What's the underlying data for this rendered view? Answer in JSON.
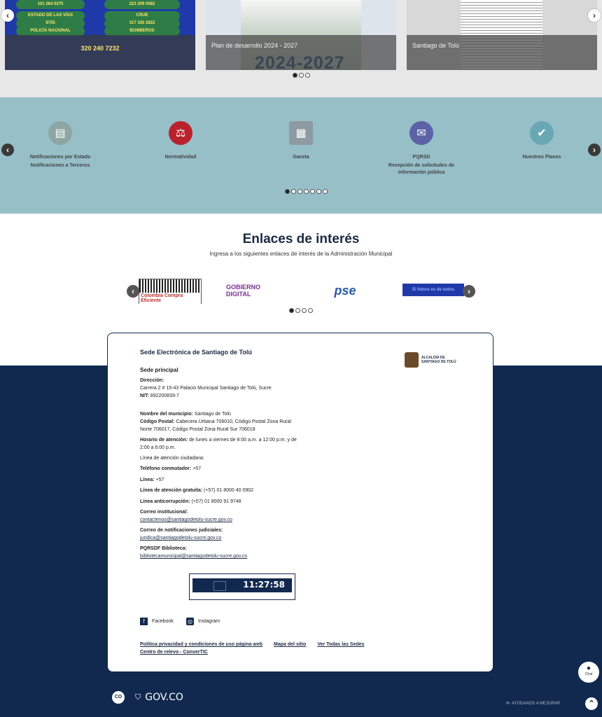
{
  "top_carousel": {
    "slides": [
      {
        "caption": "",
        "pills": [
          "101 284 0275",
          "223 209 0582",
          "ESTADO DE LAS VÍAS",
          "CRUE",
          "8755",
          "317 330 2822",
          "POLICÍA NACIONAL",
          "BOMBEROS",
          "320 240 7232"
        ]
      },
      {
        "caption": "Plan de desarrollo 2024 - 2027",
        "big_text": "2024-2027"
      },
      {
        "caption": "Santiago de Tolú"
      }
    ],
    "prev_icon": "chevron-left-icon",
    "next_icon": "chevron-right-icon",
    "dots_total": 3,
    "dots_active": 0
  },
  "services": {
    "items": [
      {
        "icon": "document-icon",
        "color": "#8da6a3",
        "label": "Notificaciones por Estado",
        "label2": "Notificaciones a Terceros"
      },
      {
        "icon": "law-book-icon",
        "color": "#b9222d",
        "label": "Normatividad",
        "label2": ""
      },
      {
        "icon": "newspaper-icon",
        "color": "#8e9aa2",
        "label": "Gaceta",
        "label2": ""
      },
      {
        "icon": "chat-bubble-icon",
        "color": "#5b62a6",
        "label": "PQRSD",
        "label2": "Recepción de solicitudes de información pública"
      },
      {
        "icon": "target-check-icon",
        "color": "#6aa7b4",
        "label": "Nuestros Planes",
        "label2": ""
      }
    ],
    "dots_total": 7,
    "dots_active": 0
  },
  "links": {
    "title": "Enlaces de interés",
    "subtitle": "Ingresa a los siguientes enlaces de interés de la Administración Municipal",
    "logos": [
      {
        "name": "Colombia Compra Eficiente",
        "color": "#b8332a"
      },
      {
        "name": "GOBIERNO DIGITAL",
        "color": "#7a2f8f"
      },
      {
        "name": "pse",
        "color": "#2b5aa8"
      },
      {
        "name": "El futuro es de todos",
        "color": "#1f3aa8"
      }
    ],
    "dots_total": 4,
    "dots_active": 0
  },
  "footer": {
    "title": "Sede Electrónica de Santiago de Tolú",
    "logo_text": "ALCALDÍA DE SANTIAGO DE TOLÚ",
    "sede": "Sede principal",
    "direccion_label": "Dirección:",
    "direccion": "Carrera 2 # 15-43 Palacio Municipal Santiago de Tolú, Sucre",
    "nit_label": "NIT:",
    "nit": "892200839-7",
    "municipio_label": "Nombre del municipio:",
    "municipio": "Santiago de Tolú",
    "postal_label": "Código Postal:",
    "postal": "Cabecera Urbana 706010, Código Postal Zona Rural Norte 706017, Código Postal Zona Rural Sur 706018",
    "horario_label": "Horario de atención:",
    "horario": "de lunes a viernes de 8:00 a.m. a 12:00 p.m. y de 2:00 a 6:00 p.m.",
    "linea_ciudadana_label": "Línea de atención ciudadana:",
    "telefono_label": "Teléfono conmutador:",
    "telefono": "+57",
    "linea_label": "Línea:",
    "linea": "+57",
    "gratuita_label": "Línea de atención gratuita:",
    "gratuita": "(+57) 01 8000 40 0902",
    "anticorrupcion_label": "Línea anticorrupción:",
    "anticorrupcion": "(+57) 01 8000 91 9748",
    "correo_label": "Correo institucional:",
    "correo": "contactenos@santiagodetolu-sucre.gov.co",
    "judicial_label": "Correo de notificaciones judiciales:",
    "judicial": "juridica@santiagodetolu-sucre.gov.co",
    "pqrsdf_label": "PQRSDF Biblioteca:",
    "pqrsdf": "bibliotecamunicipal@santiagodetolu-sucre.gov.co",
    "clock": "11:27:58",
    "social": [
      {
        "label": "Facebook",
        "icon": "facebook-icon"
      },
      {
        "label": "Instagram",
        "icon": "instagram-icon"
      }
    ],
    "bottom_links": [
      "Política privacidad y condiciones de uso página web",
      "Mapa del sitio",
      "Ver Todas las Sedes",
      "Centro de relevo - ConverTIC"
    ]
  },
  "chat": {
    "label": "Chat"
  },
  "govbar": {
    "co_badge": "CO",
    "gov": "GOV.CO",
    "help": "AYÚDANOS A MEJORAR"
  },
  "colors": {
    "navy": "#11294f",
    "teal_band": "#96bfc8",
    "text_dark": "#1b2a44"
  }
}
